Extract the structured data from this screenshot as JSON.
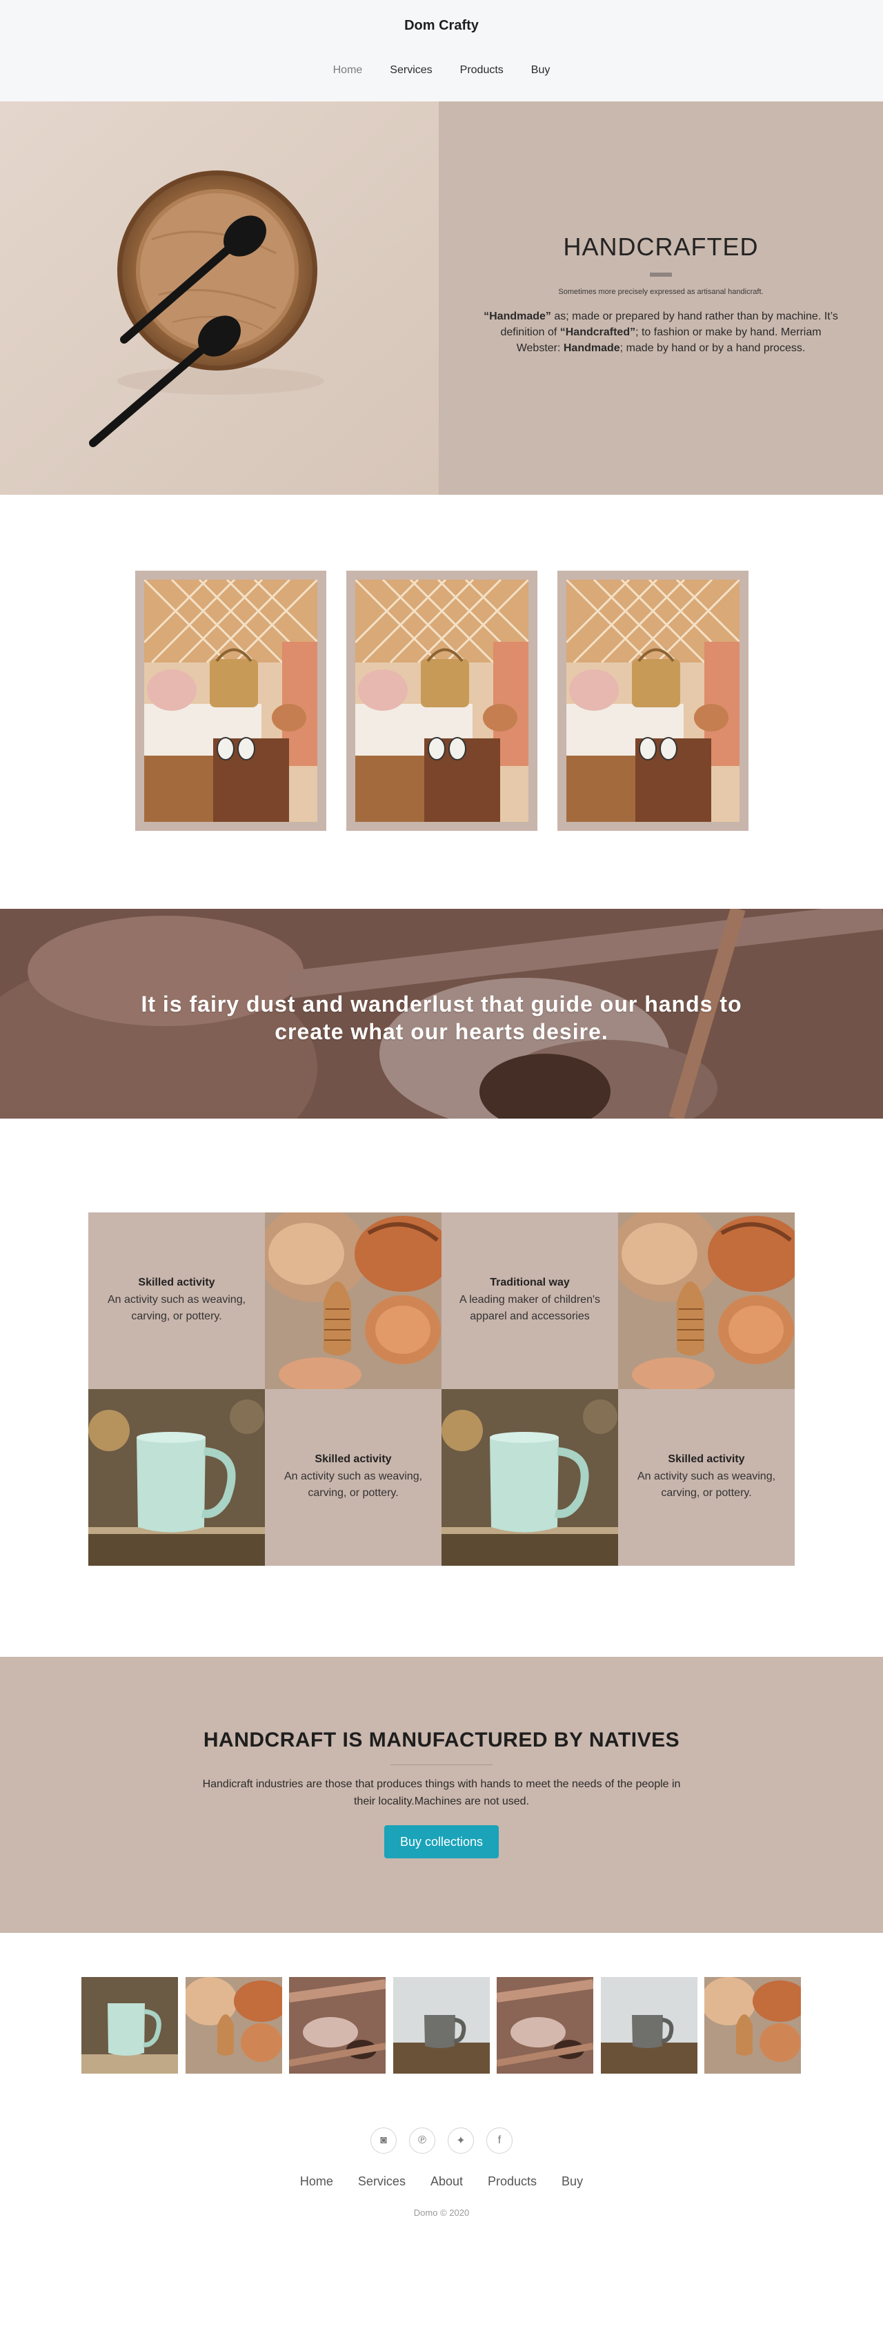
{
  "header": {
    "brand": "Dom Crafty",
    "nav": [
      {
        "label": "Home",
        "active": true
      },
      {
        "label": "Services",
        "active": false
      },
      {
        "label": "Products",
        "active": false
      },
      {
        "label": "Buy",
        "active": false
      }
    ]
  },
  "hero": {
    "title": "HANDCRAFTED",
    "subtitle": "Sometimes more precisely expressed as artisanal handicraft.",
    "desc_part1": "“Handmade”",
    "desc_part2": " as; made or prepared by hand rather than by machine. It’s definition of ",
    "desc_part3": "“Handcrafted”",
    "desc_part4": "; to fashion or make by hand. Merriam Webster: ",
    "desc_part5": "Handmade",
    "desc_part6": "; made by hand or by a hand process."
  },
  "quote": {
    "text": "It is fairy dust and wanderlust that guide our hands to create what our hearts desire."
  },
  "features": [
    {
      "title": "Skilled activity",
      "desc": "An activity such as weaving, carving, or pottery."
    },
    {
      "title": "Traditional way",
      "desc": "A leading maker of children's apparel and accessories"
    },
    {
      "title": "Skilled activity",
      "desc": "An activity such as weaving, carving, or pottery."
    },
    {
      "title": "Skilled activity",
      "desc": "An activity such as weaving, carving, or pottery."
    }
  ],
  "cta": {
    "title_bold": "HANDCRAFT IS",
    "title_rest": " MANUFACTURED BY NATIVES",
    "desc": "Handicraft industries are those that produces things with hands to meet the needs of the people in their locality.Machines are not used.",
    "button": "Buy collections",
    "button_color": "#1aa3b9"
  },
  "footer": {
    "social": [
      {
        "icon": "instagram-icon",
        "glyph": "◙"
      },
      {
        "icon": "pinterest-icon",
        "glyph": "℗"
      },
      {
        "icon": "twitter-icon",
        "glyph": "✦"
      },
      {
        "icon": "facebook-icon",
        "glyph": "f"
      }
    ],
    "nav": [
      "Home",
      "Services",
      "About",
      "Products",
      "Buy"
    ],
    "copyright": "Domo © 2020"
  },
  "colors": {
    "accent": "#1aa3b9",
    "panel": "#c8b5ac",
    "header_bg": "#f6f7f9"
  }
}
